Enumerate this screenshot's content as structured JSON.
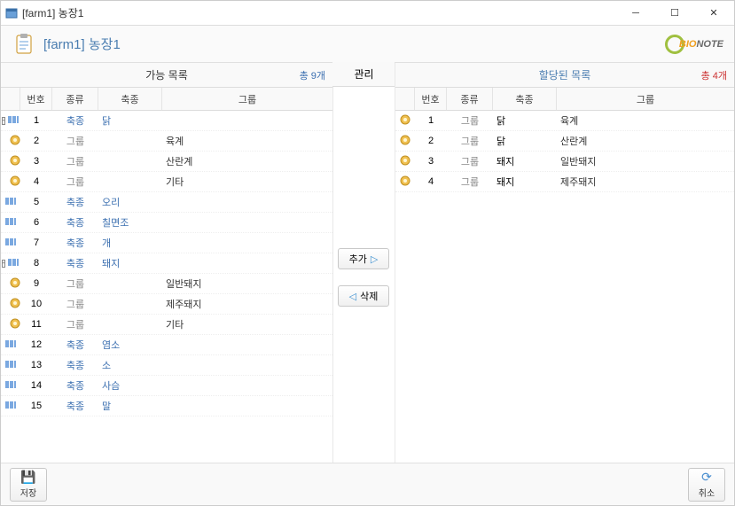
{
  "window": {
    "title": "[farm1] 농장1"
  },
  "header": {
    "title": "[farm1] 농장1",
    "logo_bio": "BIO",
    "logo_note": "NOTE"
  },
  "left": {
    "title": "가능 목록",
    "count": "총 9개",
    "cols": {
      "idx": "번호",
      "type": "종류",
      "species": "축종",
      "group": "그룹"
    },
    "rows": [
      {
        "n": "1",
        "type": "축종",
        "species": "닭",
        "group": "",
        "expand": "-",
        "link": true
      },
      {
        "n": "2",
        "type": "그룹",
        "species": "",
        "group": "육계",
        "child": true
      },
      {
        "n": "3",
        "type": "그룹",
        "species": "",
        "group": "산란계",
        "child": true
      },
      {
        "n": "4",
        "type": "그룹",
        "species": "",
        "group": "기타",
        "child": true
      },
      {
        "n": "5",
        "type": "축종",
        "species": "오리",
        "group": "",
        "link": true
      },
      {
        "n": "6",
        "type": "축종",
        "species": "칠면조",
        "group": "",
        "link": true
      },
      {
        "n": "7",
        "type": "축종",
        "species": "개",
        "group": "",
        "link": true
      },
      {
        "n": "8",
        "type": "축종",
        "species": "돼지",
        "group": "",
        "expand": "-",
        "link": true
      },
      {
        "n": "9",
        "type": "그룹",
        "species": "",
        "group": "일반돼지",
        "child": true
      },
      {
        "n": "10",
        "type": "그룹",
        "species": "",
        "group": "제주돼지",
        "child": true
      },
      {
        "n": "11",
        "type": "그룹",
        "species": "",
        "group": "기타",
        "child": true
      },
      {
        "n": "12",
        "type": "축종",
        "species": "염소",
        "group": "",
        "link": true
      },
      {
        "n": "13",
        "type": "축종",
        "species": "소",
        "group": "",
        "link": true
      },
      {
        "n": "14",
        "type": "축종",
        "species": "사슴",
        "group": "",
        "link": true
      },
      {
        "n": "15",
        "type": "축종",
        "species": "말",
        "group": "",
        "link": true
      }
    ]
  },
  "mid": {
    "title": "관리",
    "add": "추가",
    "remove": "삭제"
  },
  "right": {
    "title": "할당된 목록",
    "count": "총 4개",
    "cols": {
      "idx": "번호",
      "type": "종류",
      "species": "축종",
      "group": "그룹"
    },
    "rows": [
      {
        "n": "1",
        "type": "그룹",
        "species": "닭",
        "group": "육계"
      },
      {
        "n": "2",
        "type": "그룹",
        "species": "닭",
        "group": "산란계"
      },
      {
        "n": "3",
        "type": "그룹",
        "species": "돼지",
        "group": "일반돼지"
      },
      {
        "n": "4",
        "type": "그룹",
        "species": "돼지",
        "group": "제주돼지"
      }
    ]
  },
  "foot": {
    "save": "저장",
    "cancel": "취소"
  }
}
